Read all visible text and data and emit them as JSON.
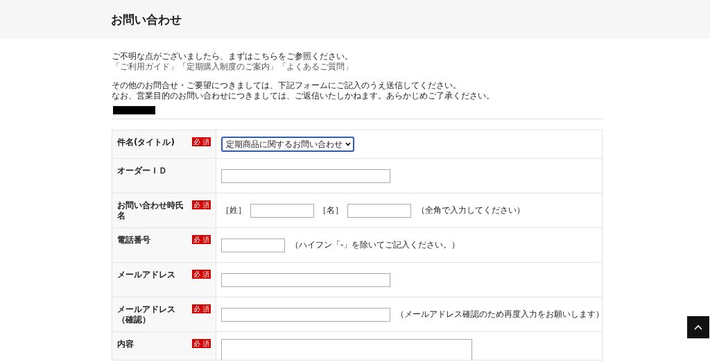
{
  "page_title": "お問い合わせ",
  "intro": {
    "line1": "ご不明な点がございましたら、まずはこちらをご参照ください。",
    "links": [
      "「ご利用ガイド」",
      "「定期購入制度のご案内」",
      "「よくあるご質問」"
    ],
    "line2": "その他のお問合せ・ご要望につきましては、下記フォームにご記入のうえ送信してください。",
    "line3": "なお、営業目的のお問い合わせにつきましては、ご返信いたしかねます。あらかじめご了承ください。"
  },
  "form_rows": [
    {
      "label": "件名(タイトル)",
      "badge": "必 須",
      "kind": "select",
      "value": "定期商品に関するお問い合わせ",
      "focused": true
    },
    {
      "label": "オーダーＩＤ",
      "kind": "input"
    },
    {
      "label": "お問い合わせ時氏名",
      "badge": "必 須",
      "kind": "name",
      "last_label": "［姓］",
      "first_label": "［名］",
      "note": "（全角で入力してください）"
    },
    {
      "label": "電話番号",
      "badge": "必 須",
      "kind": "short",
      "note": "（ハイフン「-」を除いてご記入ください。）"
    },
    {
      "label": "メールアドレス",
      "badge": "必 須",
      "kind": "input"
    },
    {
      "label": "メールアドレス（確認）",
      "badge": "必 須",
      "kind": "input",
      "note": "（メールアドレス確認のため再度入力をお願いします）"
    },
    {
      "label": "内容",
      "badge": "必 須",
      "kind": "textarea"
    }
  ]
}
